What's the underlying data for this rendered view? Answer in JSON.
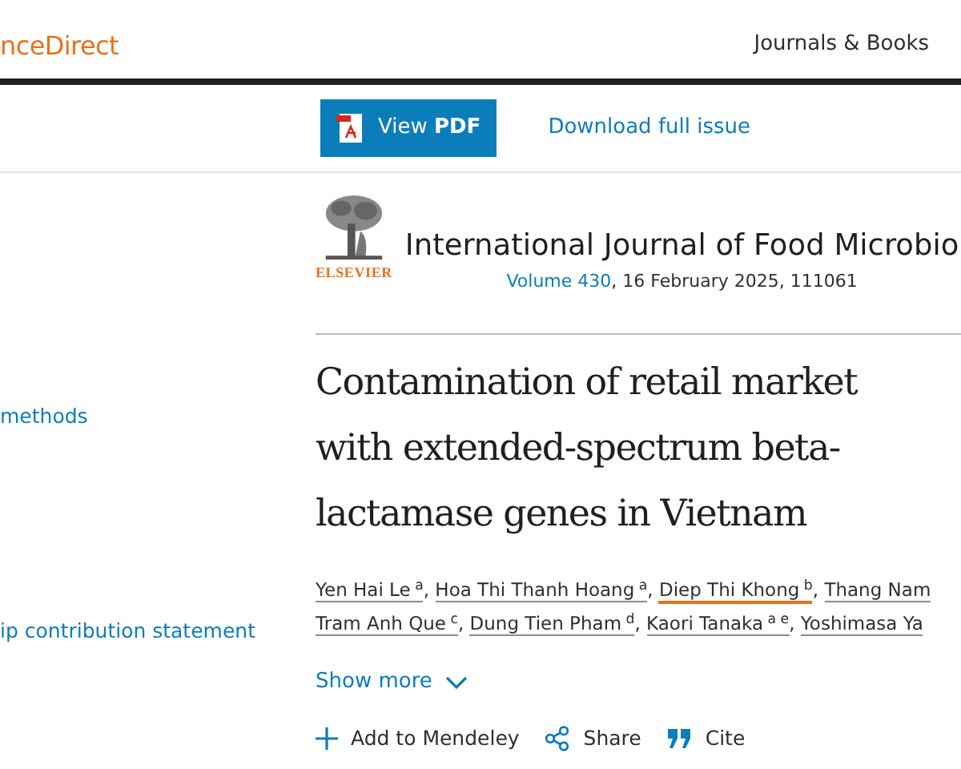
{
  "header": {
    "logo": "nceDirect",
    "nav_link": "Journals & Books"
  },
  "toolbar": {
    "pdf_button": "View PDF",
    "download_link": "Download full issue"
  },
  "sidebar": {
    "items": [
      "methods",
      "ip contribution statement"
    ]
  },
  "journal": {
    "publisher": "ELSEVIER",
    "title": "International Journal of Food Microbio",
    "volume": "Volume 430",
    "issue_info": ", 16 February 2025, 111061"
  },
  "article_title": [
    "Contamination of retail market",
    "with extended-spectrum beta-",
    "lactamase genes in Vietnam"
  ],
  "authors": [
    {
      "name": "Yen Hai Le",
      "affiliation": "a",
      "highlighted": false,
      "separator": ","
    },
    {
      "name": "Hoa Thi Thanh Hoang",
      "affiliation": "a",
      "highlighted": false,
      "separator": ","
    },
    {
      "name": "Diep Thi Khong",
      "affiliation": "b",
      "highlighted": true,
      "separator": ","
    },
    {
      "name": "Thang Nam",
      "highlighted": false
    },
    {
      "name": "Tram Anh Que",
      "affiliation": "c",
      "highlighted": false,
      "separator": ","
    },
    {
      "name": "Dung Tien Pham",
      "affiliation": "d",
      "highlighted": false,
      "separator": ","
    },
    {
      "name": "Kaori Tanaka",
      "affiliation": "a e",
      "highlighted": false,
      "separator": ","
    },
    {
      "name": "Yoshimasa Ya",
      "highlighted": false
    }
  ],
  "show_more": "Show more",
  "actions": [
    {
      "kind": "mendeley",
      "label": "Add to Mendeley"
    },
    {
      "kind": "share",
      "label": "Share"
    },
    {
      "kind": "cite",
      "label": "Cite"
    }
  ]
}
